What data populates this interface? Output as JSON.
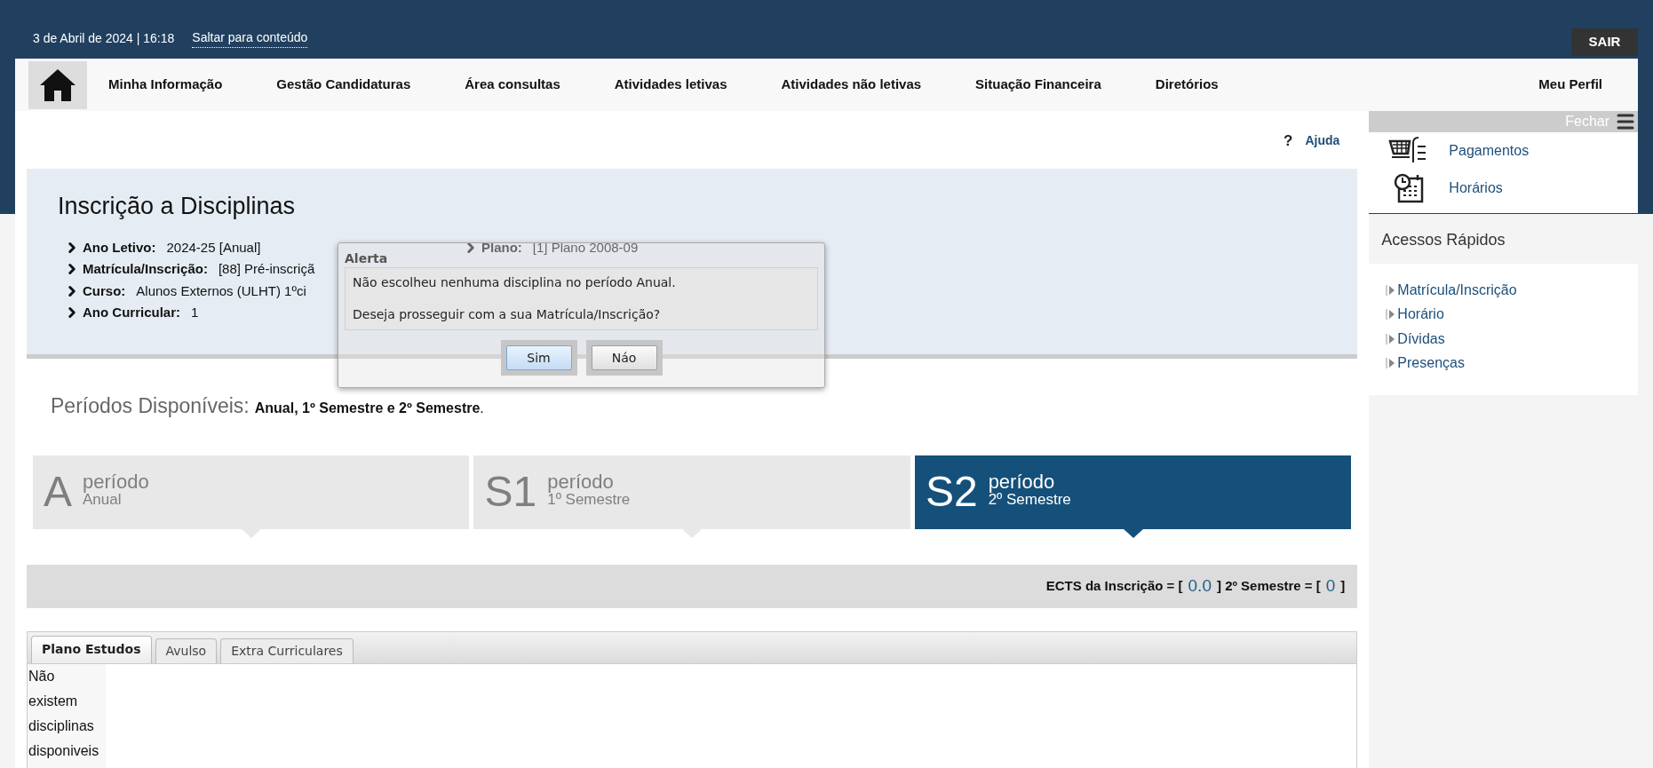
{
  "top_bar": {
    "date_time": "3 de Abril de 2024 | 16:18",
    "skip_link": "Saltar para conteúdo",
    "logout": "SAIR"
  },
  "nav": {
    "items": [
      "Minha Informação",
      "Gestão Candidaturas",
      "Área consultas",
      "Atividades letivas",
      "Atividades não letivas",
      "Situação Financeira",
      "Diretórios"
    ],
    "profile": "Meu Perfil"
  },
  "help": {
    "icon": "?",
    "label": "Ajuda"
  },
  "page_header": {
    "title": "Inscrição a Disciplinas",
    "info": [
      {
        "label": "Ano Letivo:",
        "value": "2024-25 [Anual]"
      },
      {
        "label": "Matrícula/Inscrição:",
        "value": "[88] Pré-inscriçã"
      },
      {
        "label": "Curso:",
        "value": "Alunos Externos (ULHT) 1ºci"
      },
      {
        "label": "Ano Curricular:",
        "value": "1"
      }
    ],
    "side_info": [
      {
        "label": "Plano:",
        "value": "[1] Plano 2008-09"
      }
    ]
  },
  "alert": {
    "title": "Alerta",
    "messages": [
      "Não escolheu nenhuma disciplina no período Anual.",
      "Deseja prosseguir com a sua Matrícula/Inscrição?"
    ],
    "buttons": [
      {
        "label": "Sim",
        "focused": true
      },
      {
        "label": "Náo",
        "focused": false
      }
    ]
  },
  "periods": {
    "heading": "Períodos Disponíveis:",
    "summary": "**Anual, 1º Semestre e 2º Semestre**.",
    "tiles": [
      {
        "code": "A",
        "caption": "período",
        "name": "Anual",
        "selected": false
      },
      {
        "code": "S1",
        "caption": "período",
        "name": "1º Semestre",
        "selected": false
      },
      {
        "code": "S2",
        "caption": "período",
        "name": "2º Semestre",
        "selected": true
      }
    ]
  },
  "ects": [
    {
      "kind": "label",
      "text": "ECTS da Inscrição = ["
    },
    {
      "kind": "value",
      "text": "0.0"
    },
    {
      "kind": "label",
      "text": "] 2º Semestre = ["
    },
    {
      "kind": "value",
      "text": "0"
    },
    {
      "kind": "label",
      "text": "]"
    }
  ],
  "tabs": [
    {
      "label": "Plano Estudos",
      "selected": true
    },
    {
      "label": "Avulso",
      "selected": false
    },
    {
      "label": "Extra Curriculares",
      "selected": false
    }
  ],
  "empty_message": "Não existem disciplinas disponiveis",
  "sidebar": {
    "close_label": "Fechar",
    "shortcuts": [
      {
        "kind": "payments",
        "label": "Pagamentos"
      },
      {
        "kind": "schedule",
        "label": "Horários"
      }
    ],
    "quick_access_title": "Acessos Rápidos",
    "links": [
      "Matrícula/Inscrição",
      "Horário",
      "Dívidas",
      "Presenças"
    ]
  }
}
